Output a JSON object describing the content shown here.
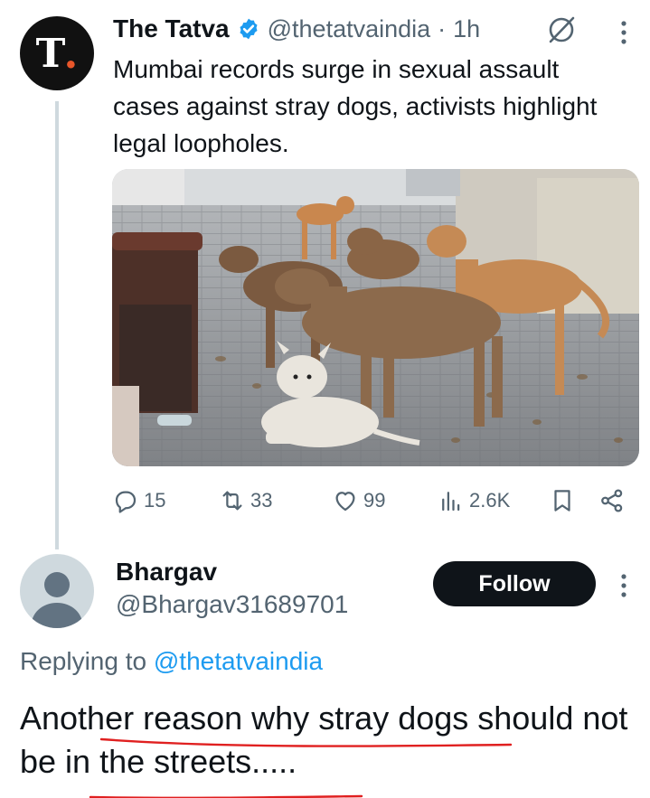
{
  "tweet": {
    "avatar_letter": "T",
    "avatar_dot": ".",
    "display_name": "The Tatva",
    "handle": "@thetatvaindia",
    "separator": "·",
    "time": "1h",
    "text": "Mumbai records surge in sexual assault cases against stray dogs, activists highlight legal loopholes.",
    "image_icon": "stray-dogs-photo",
    "stats": {
      "replies": "15",
      "reposts": "33",
      "likes": "99",
      "views": "2.6K"
    }
  },
  "reply": {
    "display_name": "Bhargav",
    "handle": "@Bhargav31689701",
    "follow_label": "Follow",
    "replying_prefix": "Replying to ",
    "replying_handle": "@thetatvaindia",
    "text": "Another reason why stray dogs should not be in the streets....."
  },
  "colors": {
    "text": "#0f1419",
    "secondary": "#536471",
    "link": "#1d9bf0",
    "verified": "#1d9bf0",
    "thread_line": "#cfd9de",
    "annotation": "#e02020"
  }
}
